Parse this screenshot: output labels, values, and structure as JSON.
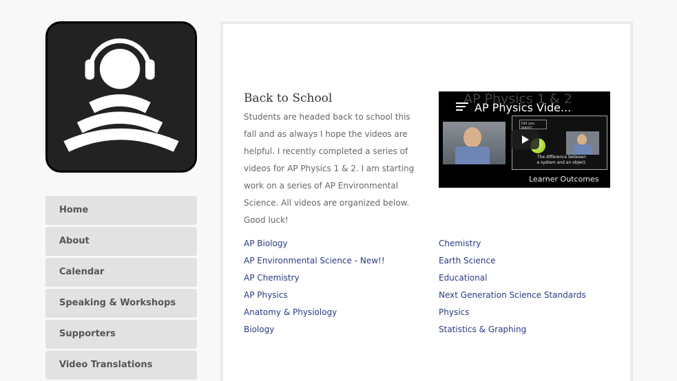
{
  "logo": {
    "icon": "headphones-broadcast-logo",
    "colors": {
      "background": "#222222",
      "foreground": "#ffffff"
    }
  },
  "nav": {
    "items": [
      {
        "label": "Home"
      },
      {
        "label": "About"
      },
      {
        "label": "Calendar"
      },
      {
        "label": "Speaking & Workshops"
      },
      {
        "label": "Supporters"
      },
      {
        "label": "Video Translations"
      }
    ]
  },
  "post": {
    "title": "Back to School",
    "body": "Students are headed back to school this fall and as always I hope the videos are helpful.  I recently completed a series of videos for AP Physics 1 & 2.  I am starting work on a series of AP Environmental Science.  All videos are organized below.  Good luck!"
  },
  "video": {
    "title": "AP Physics Vide...",
    "background_title": "AP Physics 1 & 2",
    "learn_box": "Did you learn?",
    "slide_text": "The difference between a system and an object.",
    "caption": "Learner Outcomes"
  },
  "links": {
    "left": [
      "AP Biology",
      "AP Environmental Science - New!!",
      "AP Chemistry",
      "AP Physics",
      "Anatomy & Physiology",
      "Biology"
    ],
    "right": [
      "Chemistry",
      "Earth Science",
      "Educational",
      "Next Generation Science Standards",
      "Physics",
      "Statistics & Graphing"
    ]
  },
  "colors": {
    "link": "#2a3a80",
    "nav_bg": "#e2e2e2",
    "page_bg": "#f8f8f8"
  }
}
